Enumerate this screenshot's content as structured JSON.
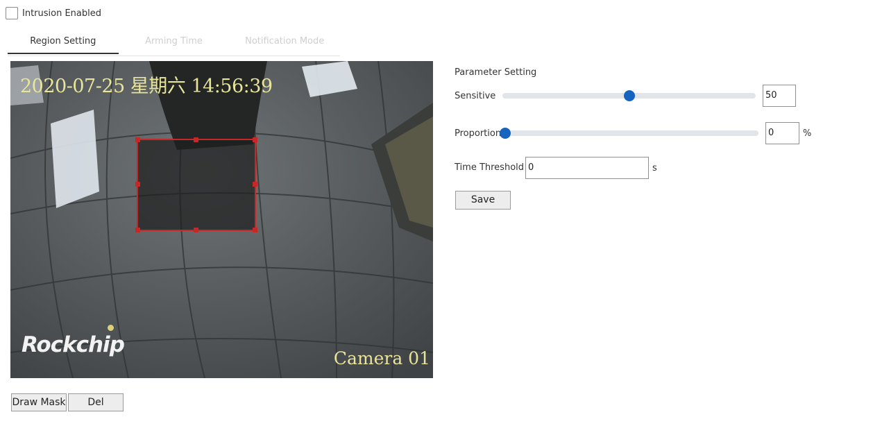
{
  "enable": {
    "label": "Intrusion Enabled",
    "checked": false
  },
  "tabs": [
    {
      "label": "Region Setting",
      "active": true
    },
    {
      "label": "Arming Time",
      "active": false
    },
    {
      "label": "Notification Mode",
      "active": false
    }
  ],
  "video": {
    "timestamp": "2020-07-25 星期六 14:56:39",
    "camera_label": "Camera 01",
    "logo_text": "Rockchip"
  },
  "buttons": {
    "draw_mask": "Draw Mask",
    "delete": "Del"
  },
  "params": {
    "title": "Parameter Setting",
    "sensitive": {
      "label": "Sensitive",
      "value": "50",
      "slider_fraction": 0.5
    },
    "proportion": {
      "label": "Proportion",
      "value": "0",
      "unit": "%",
      "slider_fraction": 0.0
    },
    "time_threshold": {
      "label": "Time Threshold",
      "value": "0",
      "unit": "s"
    },
    "save_label": "Save"
  },
  "colors": {
    "accent": "#1565c0",
    "region_border": "#c62828",
    "osd_text": "#e8e49a"
  }
}
